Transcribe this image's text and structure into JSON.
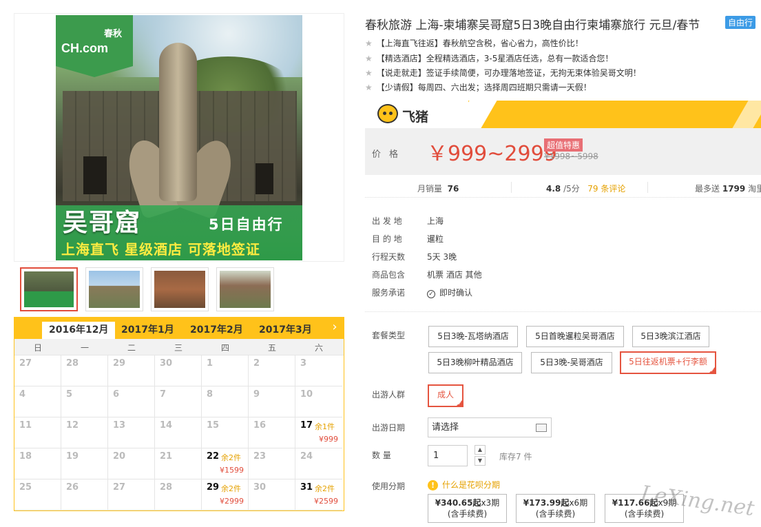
{
  "hero": {
    "logo": "CH.com",
    "logo_sub": "春秋",
    "logo_com": ".com",
    "title_big": "吴哥窟",
    "title_right": "5日自由行",
    "slogan": "上海直飞 星级酒店 可落地签证"
  },
  "calendar": {
    "months": [
      "2016年12月",
      "2017年1月",
      "2017年2月",
      "2017年3月"
    ],
    "weekdays": [
      "日",
      "一",
      "二",
      "三",
      "四",
      "五",
      "六"
    ],
    "weeks": [
      [
        {
          "d": "27"
        },
        {
          "d": "28"
        },
        {
          "d": "29"
        },
        {
          "d": "30"
        },
        {
          "d": "1"
        },
        {
          "d": "2"
        },
        {
          "d": "3"
        }
      ],
      [
        {
          "d": "4"
        },
        {
          "d": "5"
        },
        {
          "d": "6"
        },
        {
          "d": "7"
        },
        {
          "d": "8"
        },
        {
          "d": "9"
        },
        {
          "d": "10"
        }
      ],
      [
        {
          "d": "11"
        },
        {
          "d": "12"
        },
        {
          "d": "13"
        },
        {
          "d": "14"
        },
        {
          "d": "15"
        },
        {
          "d": "16"
        },
        {
          "d": "17",
          "left": "余1件",
          "price": "¥999"
        }
      ],
      [
        {
          "d": "18"
        },
        {
          "d": "19"
        },
        {
          "d": "20"
        },
        {
          "d": "21"
        },
        {
          "d": "22",
          "left": "余2件",
          "price": "¥1599"
        },
        {
          "d": "23"
        },
        {
          "d": "24"
        }
      ],
      [
        {
          "d": "25"
        },
        {
          "d": "26"
        },
        {
          "d": "27"
        },
        {
          "d": "28"
        },
        {
          "d": "29",
          "left": "余2件",
          "price": "¥2999"
        },
        {
          "d": "30"
        },
        {
          "d": "31",
          "left": "余2件",
          "price": "¥2599"
        }
      ]
    ]
  },
  "product": {
    "title": "春秋旅游 上海-柬埔寨吴哥窟5日3晚自由行柬埔寨旅行 元旦/春节",
    "tag": "自由行",
    "features": [
      "【上海直飞往返】春秋航空含税，省心省力，高性价比！",
      "【精选酒店】全程精选酒店，3-5星酒店任选，总有一款适合您！",
      "【说走就走】签证手续简便，可办理落地签证，无拘无束体验吴哥文明！",
      "【少请假】每周四、六出发；选择周四班期只需请一天假！"
    ],
    "platform": "飞猪",
    "price_label": "价格",
    "price": "￥999~2999",
    "price_badge": "超值特惠",
    "price_old": "¥1998~5998",
    "stats": {
      "monthly_label": "月销量",
      "monthly_value": "76",
      "rating_value": "4.8",
      "rating_unit": "/5分",
      "reviews": "79 条评论",
      "points_label": "最多送",
      "points_value": "1799",
      "points_unit": "淘里程"
    },
    "info": [
      {
        "label": "出 发 地",
        "value": "上海"
      },
      {
        "label": "目 的 地",
        "value": "暹粒"
      },
      {
        "label": "行程天数",
        "value": "5天 3晚"
      },
      {
        "label": "商品包含",
        "value": "机票   酒店   其他"
      },
      {
        "label": "服务承诺",
        "value": "即时确认"
      }
    ]
  },
  "order": {
    "package_label": "套餐类型",
    "packages": [
      "5日3晚-瓦塔纳酒店",
      "5日首晚暹粒吴哥酒店",
      "5日3晚滨江酒店",
      "5日3晚柳叶精品酒店",
      "5日3晚-吴哥酒店",
      "5日往返机票+行李额"
    ],
    "people_label": "出游人群",
    "people_option": "成人",
    "date_label": "出游日期",
    "date_value": "请选择",
    "qty_label": "数      量",
    "qty_value": "1",
    "stock": "库存7 件",
    "install_label": "使用分期",
    "huabei": "什么是花呗分期",
    "installments": [
      {
        "amount": "¥340.65起",
        "period": "x3期",
        "fee": "(含手续费)"
      },
      {
        "amount": "¥173.99起",
        "period": "x6期",
        "fee": "(含手续费)"
      },
      {
        "amount": "¥117.66起",
        "period": "x9期",
        "fee": "(含手续费)"
      }
    ]
  },
  "watermark": "LeXing.net"
}
